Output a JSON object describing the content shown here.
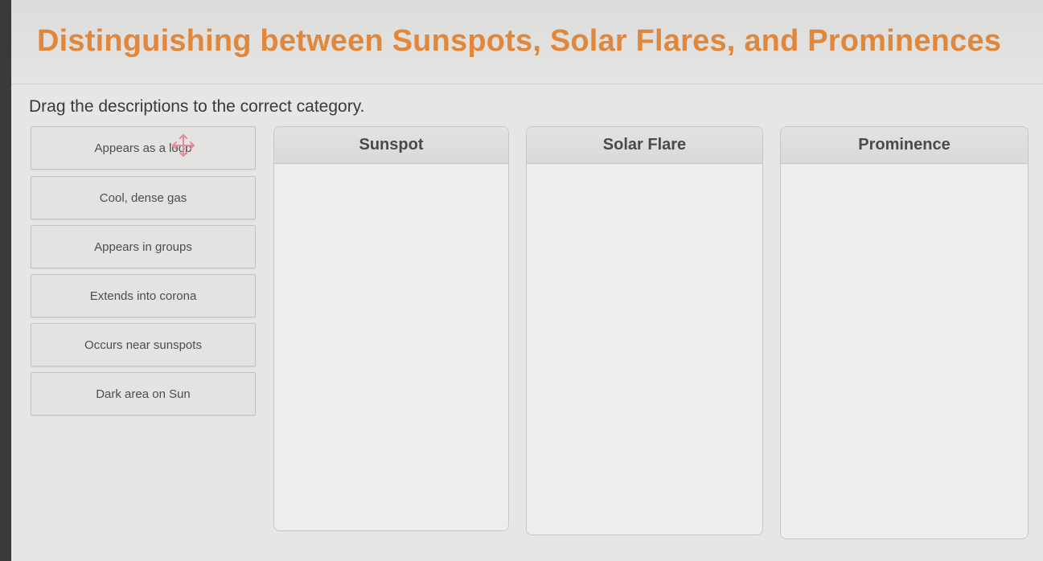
{
  "page": {
    "title": "Distinguishing between Sunspots, Solar Flares, and Prominences",
    "instruction": "Drag the descriptions to the correct category."
  },
  "tiles": [
    {
      "label": "Appears as a loop"
    },
    {
      "label": "Cool, dense gas"
    },
    {
      "label": "Appears in groups"
    },
    {
      "label": "Extends into corona"
    },
    {
      "label": "Occurs near sunspots"
    },
    {
      "label": "Dark area on Sun"
    }
  ],
  "categories": [
    {
      "label": "Sunspot"
    },
    {
      "label": "Solar Flare"
    },
    {
      "label": "Prominence"
    }
  ],
  "colors": {
    "title": "#e0873c",
    "move_icon": "#e8899b"
  },
  "icons": {
    "drag_cursor": "move-cursor-icon"
  }
}
